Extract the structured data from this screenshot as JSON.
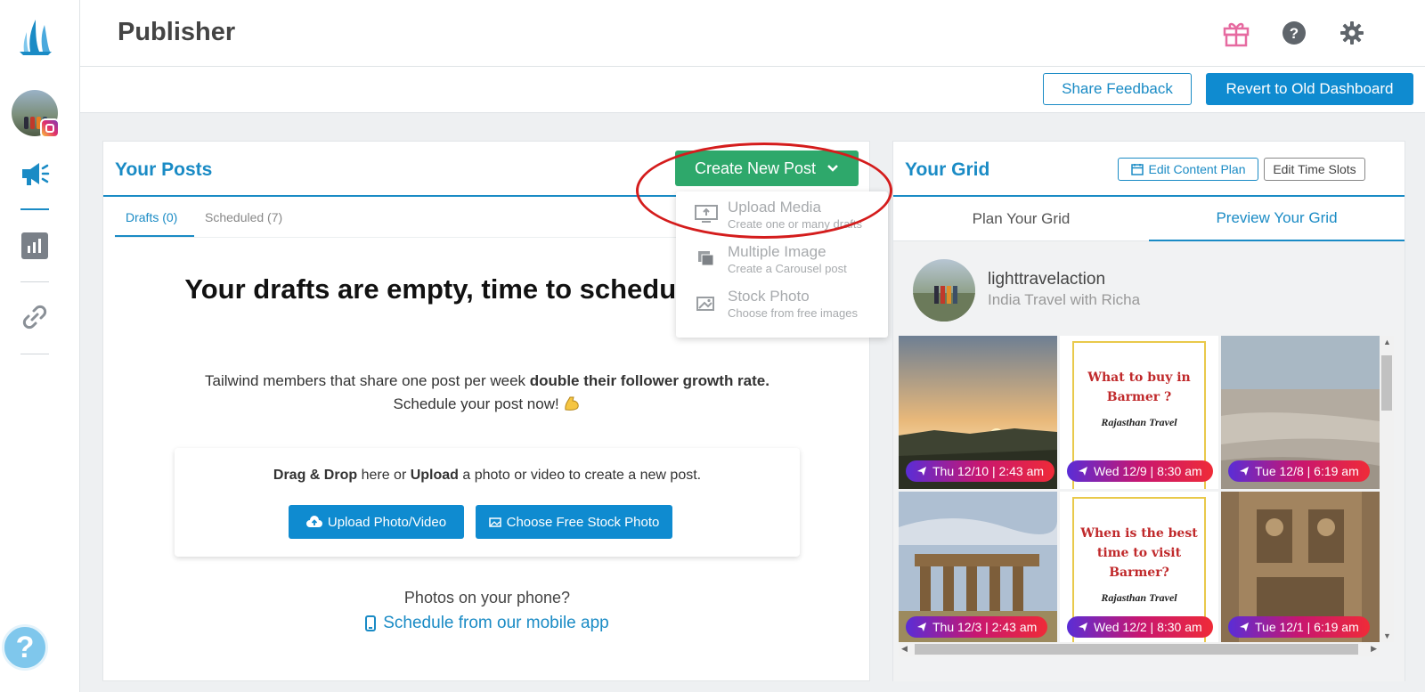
{
  "header": {
    "title": "Publisher"
  },
  "subbar": {
    "share_feedback": "Share Feedback",
    "revert": "Revert to Old Dashboard"
  },
  "posts": {
    "title": "Your Posts",
    "create_btn": "Create New Post",
    "tabs": [
      {
        "label": "Drafts (0)",
        "active": true
      },
      {
        "label": "Scheduled (7)",
        "active": false
      }
    ],
    "empty_title": "Your drafts are empty, time to schedule posts!",
    "empty_desc_pre": "Tailwind members that share one post per week ",
    "empty_desc_bold": "double their follower growth rate.",
    "empty_desc_line2": "Schedule your post now!",
    "drop": {
      "b1": "Drag & Drop",
      "t1": " here or ",
      "b2": "Upload",
      "t2": " a photo or video to create a new post.",
      "upload_btn": "Upload Photo/Video",
      "stock_btn": "Choose Free Stock Photo"
    },
    "phone_question": "Photos on your phone?",
    "mobile_link": "Schedule from our mobile app"
  },
  "dropdown": {
    "items": [
      {
        "title": "Upload Media",
        "sub": "Create one or many drafts",
        "icon": "monitor-upload-icon"
      },
      {
        "title": "Multiple Image",
        "sub": "Create a Carousel post",
        "icon": "stacked-images-icon"
      },
      {
        "title": "Stock Photo",
        "sub": "Choose from free images",
        "icon": "stock-photo-icon"
      }
    ]
  },
  "grid": {
    "title": "Your Grid",
    "edit_content_plan": "Edit Content Plan",
    "edit_time_slots": "Edit Time Slots",
    "tabs": [
      {
        "label": "Plan Your Grid",
        "active": false
      },
      {
        "label": "Preview Your Grid",
        "active": true
      }
    ],
    "profile": {
      "username": "lighttravelaction",
      "bio": "India Travel with Richa"
    },
    "tiles": [
      {
        "date": "Thu 12/10 | 2:43 am",
        "kind": "sunset"
      },
      {
        "date": "Wed 12/9 | 8:30 am",
        "kind": "poster",
        "poster_title": "What to buy in Barmer ?",
        "poster_sub": "Rajasthan Travel"
      },
      {
        "date": "Tue 12/8 | 6:19 am",
        "kind": "beach"
      },
      {
        "date": "Thu 12/3 | 2:43 am",
        "kind": "temple"
      },
      {
        "date": "Wed 12/2 | 8:30 am",
        "kind": "poster",
        "poster_title": "When is the best time to visit Barmer?",
        "poster_sub": "Rajasthan Travel"
      },
      {
        "date": "Tue 12/1 | 6:19 am",
        "kind": "carving"
      }
    ]
  },
  "colors": {
    "brand_blue": "#1a8bc5",
    "create_green": "#2ea86b",
    "annotation_red": "#d41c1c"
  }
}
